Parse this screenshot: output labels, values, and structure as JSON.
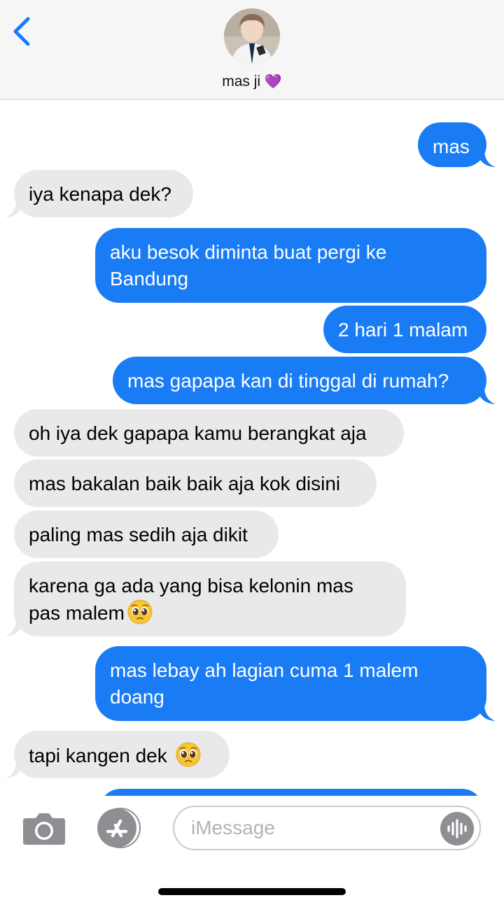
{
  "header": {
    "contact_name": "mas ji",
    "contact_emoji": "💜"
  },
  "messages": [
    {
      "side": "sent",
      "text": "mas"
    },
    {
      "side": "received",
      "text": "iya kenapa dek?"
    },
    {
      "side": "sent",
      "lines": [
        "aku besok diminta buat pergi ke",
        "Bandung"
      ]
    },
    {
      "side": "sent",
      "text": "2 hari 1 malam"
    },
    {
      "side": "sent",
      "text": "mas gapapa kan di tinggal di rumah?"
    },
    {
      "side": "received",
      "text": "oh iya dek gapapa kamu berangkat aja"
    },
    {
      "side": "received",
      "text": "mas bakalan baik baik aja kok disini"
    },
    {
      "side": "received",
      "text": "paling mas sedih aja dikit"
    },
    {
      "side": "received",
      "lines": [
        "karena ga ada yang bisa kelonin mas",
        "pas malem"
      ],
      "emoji": "pleading-face"
    },
    {
      "side": "sent",
      "lines": [
        "mas lebay ah lagian cuma 1 malem",
        "doang"
      ]
    },
    {
      "side": "received",
      "text": "tapi kangen dek ",
      "emoji": "pleading-face"
    }
  ],
  "composer": {
    "placeholder": "iMessage"
  },
  "colors": {
    "sent_bubble": "#1a7cf5",
    "received_bubble": "#e9e9eb",
    "accent": "#1a7cf5"
  },
  "icons": [
    "chevron-left-icon",
    "camera-icon",
    "app-store-icon",
    "audio-waveform-icon",
    "pleading-face-emoji"
  ]
}
